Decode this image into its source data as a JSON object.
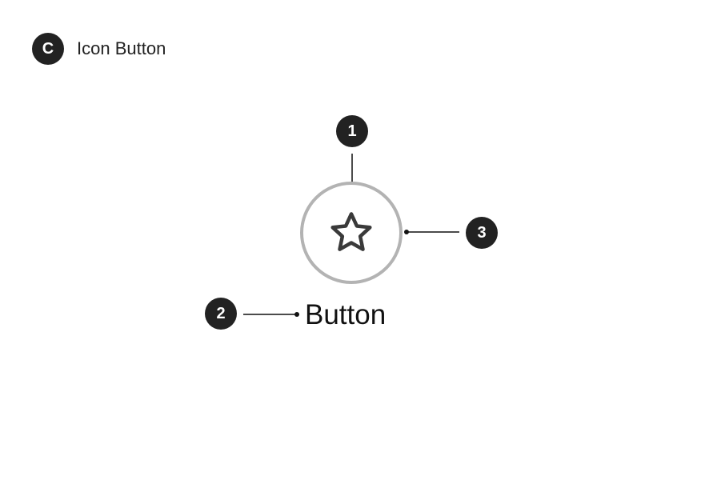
{
  "header": {
    "badge": "C",
    "title": "Icon Button"
  },
  "markers": {
    "one": "1",
    "two": "2",
    "three": "3"
  },
  "component": {
    "icon": "star-icon",
    "label": "Button"
  },
  "colors": {
    "badge": "#222222",
    "ring": "#b3b3b3",
    "icon": "#3a3a3a"
  }
}
